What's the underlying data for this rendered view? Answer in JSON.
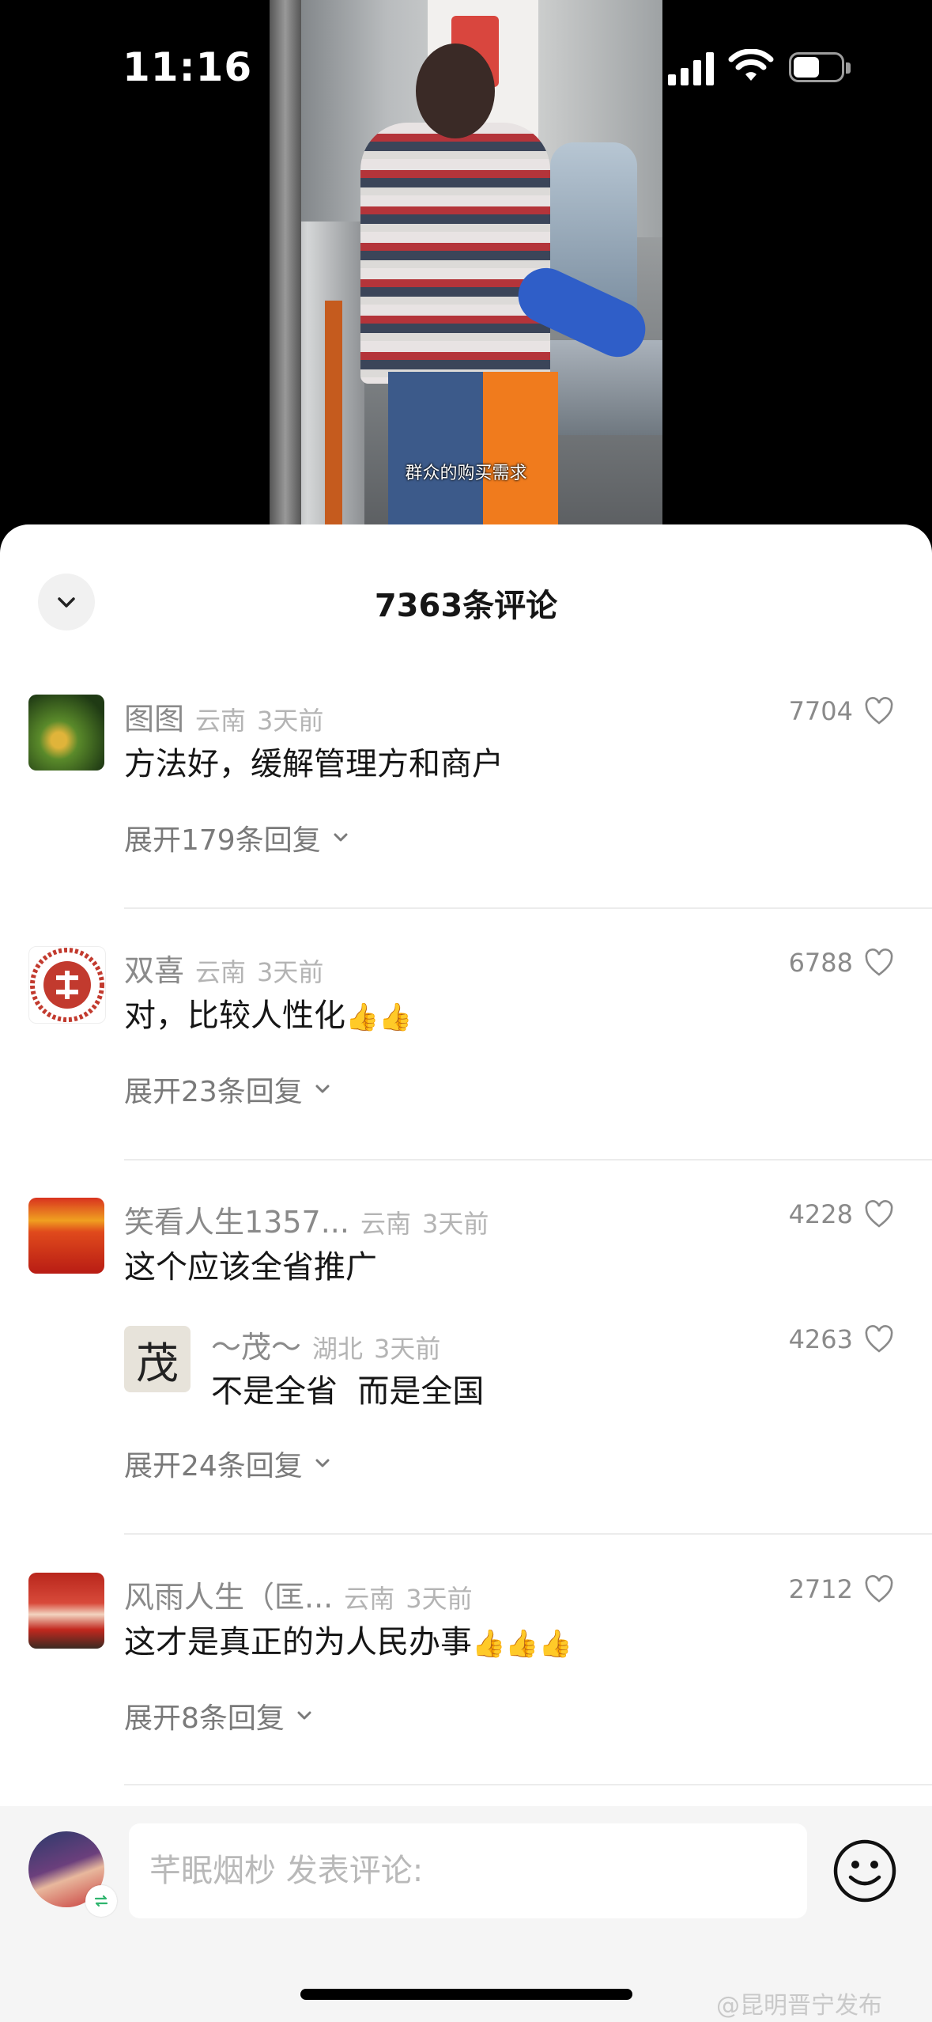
{
  "status_bar": {
    "time": "11:16",
    "battery_level": 0.55
  },
  "video": {
    "subtitle": "群众的购买需求"
  },
  "sheet": {
    "title": "7363条评论"
  },
  "comments": [
    {
      "user": "图图",
      "location": "云南",
      "time": "3天前",
      "text": "方法好，缓解管理方和商户",
      "likes": "7704",
      "expand_label": "展开179条回复"
    },
    {
      "user": "双喜",
      "location": "云南",
      "time": "3天前",
      "text": "对，比较人性化",
      "emoji": "👍👍",
      "likes": "6788",
      "expand_label": "展开23条回复"
    },
    {
      "user": "笑看人生1357...",
      "location": "云南",
      "time": "3天前",
      "text": "这个应该全省推广",
      "likes": "4228",
      "reply": {
        "user": "～茂～",
        "location": "湖北",
        "time": "3天前",
        "text": "不是全省  而是全国",
        "likes": "4263",
        "avatar_char": "茂"
      },
      "expand_label": "展开24条回复"
    },
    {
      "user": "风雨人生（匡...",
      "location": "云南",
      "time": "3天前",
      "text": "这才是真正的为人民办事",
      "emoji": "👍👍👍",
      "likes": "2712",
      "expand_label": "展开8条回复"
    }
  ],
  "input": {
    "placeholder": "芊眠烟杪 发表评论:"
  },
  "watermark": "@昆明晋宁发布",
  "icons": {
    "collapse": "chevron-down-icon",
    "like": "heart-outline-icon",
    "expand": "chevron-down-icon",
    "emoji": "smiley-icon",
    "swap": "swap-icon"
  },
  "colors": {
    "sheet_bg": "#ffffff",
    "meta_text": "#b4b4b4",
    "input_bar_bg": "#f5f5f5"
  }
}
